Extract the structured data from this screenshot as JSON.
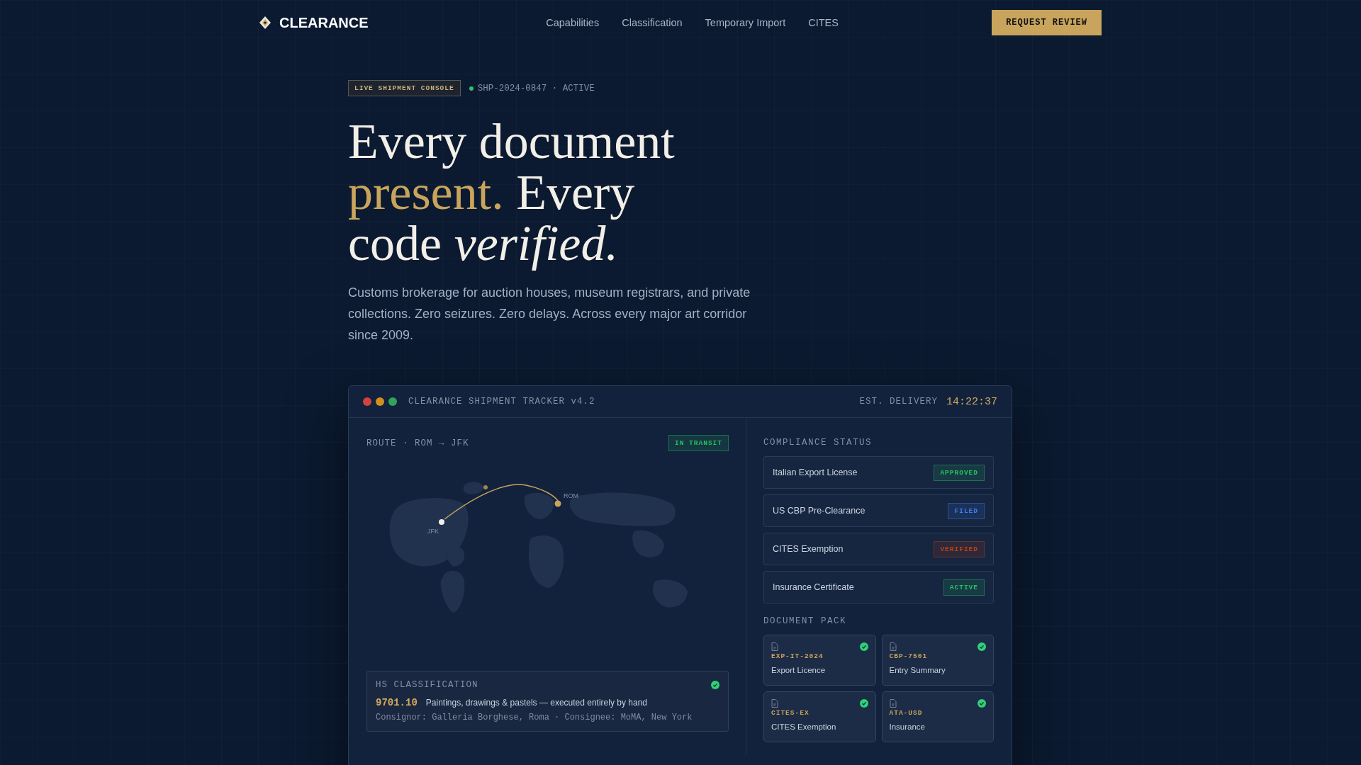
{
  "nav": {
    "brand": "CLEARANCE",
    "links": [
      "Capabilities",
      "Classification",
      "Temporary Import",
      "CITES"
    ],
    "cta": "REQUEST REVIEW"
  },
  "hero": {
    "tag": "LIVE SHIPMENT CONSOLE",
    "status": "SHP-2024-0847 · ACTIVE",
    "headline": [
      {
        "text": "Every document ",
        "kind": "plain"
      },
      {
        "text": "present.",
        "kind": "accent"
      },
      {
        "text": " Every code ",
        "kind": "plain"
      },
      {
        "text": "verified.",
        "kind": "italic"
      }
    ],
    "description": "Customs brokerage for auction houses, museum registrars, and private collections. Zero seizures. Zero delays. Across every major art corridor since 2009."
  },
  "tracker": {
    "title": "CLEARANCE SHIPMENT TRACKER v4.2",
    "delivery_label": "EST. DELIVERY",
    "delivery_time": "14:22:37",
    "route": {
      "label": "ROUTE · ROM → JFK",
      "badge": "IN TRANSIT",
      "origin": "ROM",
      "destination": "JFK"
    },
    "hs": {
      "title": "HS CLASSIFICATION",
      "checked": true,
      "code": "9701.10",
      "description": "Paintings, drawings & pastels — executed entirely by hand",
      "parties": "Consignor: Galleria Borghese, Roma · Consignee: MoMA, New York"
    },
    "compliance_title": "COMPLIANCE STATUS",
    "compliance": [
      {
        "name": "Italian Export License",
        "status": "APPROVED",
        "color": "#22c55e"
      },
      {
        "name": "US CBP Pre-Clearance",
        "status": "FILED",
        "color": "#3b82f6"
      },
      {
        "name": "CITES Exemption",
        "status": "VERIFIED",
        "color": "#c2410c"
      },
      {
        "name": "Insurance Certificate",
        "status": "ACTIVE",
        "color": "#22c55e"
      }
    ],
    "documents_title": "DOCUMENT PACK",
    "documents": [
      {
        "code": "EXP-IT-2024",
        "name": "Export Licence",
        "checked": true
      },
      {
        "code": "CBP-7501",
        "name": "Entry Summary",
        "checked": true
      },
      {
        "code": "CITES-EX",
        "name": "CITES Exemption",
        "checked": true
      },
      {
        "code": "ATA-USD",
        "name": "Insurance",
        "checked": true
      }
    ]
  }
}
